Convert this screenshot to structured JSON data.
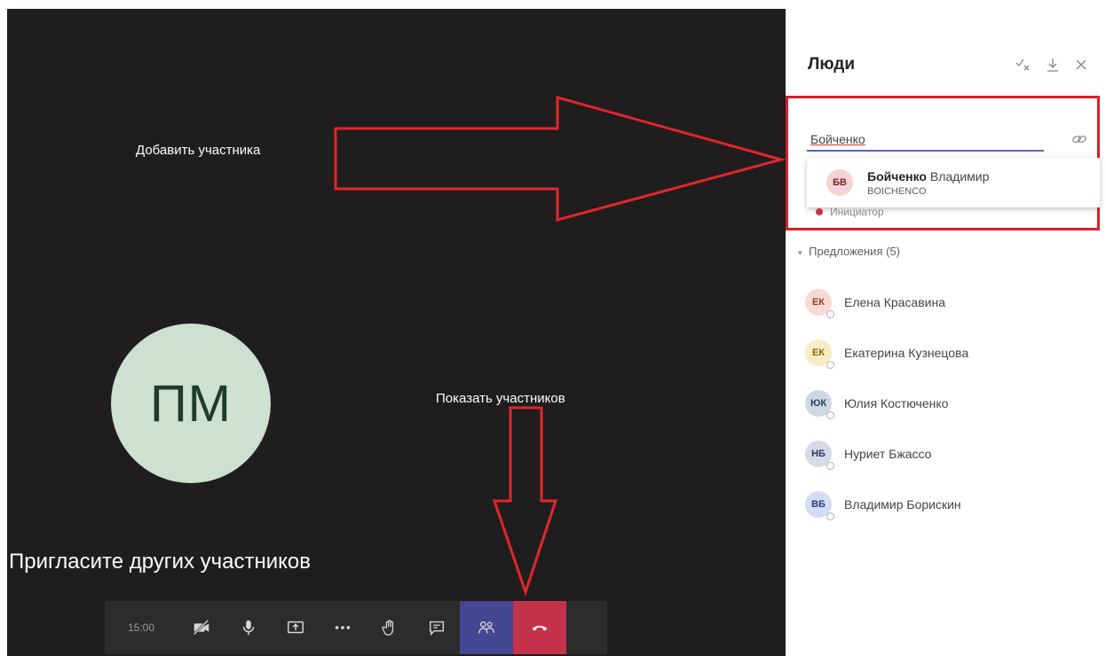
{
  "stage": {
    "avatar_initials": "ПМ",
    "invite_text": "Пригласите других участников",
    "annotation_add": "Добавить участника",
    "annotation_show": "Показать участников"
  },
  "toolbar": {
    "timer": "15:00",
    "buttons": [
      {
        "name": "camera-off-icon"
      },
      {
        "name": "microphone-icon"
      },
      {
        "name": "share-screen-icon"
      },
      {
        "name": "more-options-icon"
      },
      {
        "name": "raise-hand-icon"
      },
      {
        "name": "chat-icon"
      },
      {
        "name": "participants-icon"
      },
      {
        "name": "hang-up-icon"
      }
    ],
    "colors": {
      "bar": "#2d2c2c",
      "active": "#444791",
      "hangup": "#c4314b"
    }
  },
  "panel": {
    "title": "Люди",
    "search": {
      "value": "Бойченко"
    },
    "suggestion": {
      "initials": "БВ",
      "name_bold": "Бойченко",
      "name_rest": "Владимир",
      "subtitle": "BOICHENCO"
    },
    "initiator_label": "Инициатор",
    "suggestions_header": "Предложения (5)",
    "people": [
      {
        "initials": "ЕК",
        "name": "Елена Красавина",
        "bg": "#fbd9d3",
        "fg": "#a33a2a"
      },
      {
        "initials": "ЕК",
        "name": "Екатерина Кузнецова",
        "bg": "#f7ecc4",
        "fg": "#8a6a14"
      },
      {
        "initials": "ЮК",
        "name": "Юлия Костюченко",
        "bg": "#cfd8e4",
        "fg": "#2c3e57"
      },
      {
        "initials": "НБ",
        "name": "Нуриет Бжассо",
        "bg": "#d5dbe6",
        "fg": "#2f3d58"
      },
      {
        "initials": "ВБ",
        "name": "Владимир Борискин",
        "bg": "#d4dcf3",
        "fg": "#2c3d7a"
      }
    ]
  },
  "accent": "#d9202a"
}
